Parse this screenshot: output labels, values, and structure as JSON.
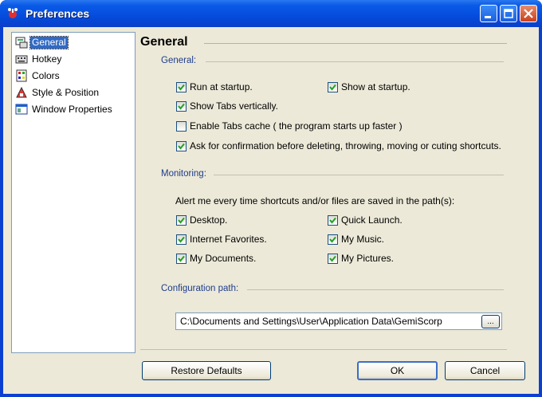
{
  "window": {
    "title": "Preferences",
    "accent": "#0a3fd0"
  },
  "sidebar": {
    "items": [
      {
        "label": "General",
        "icon": "general-settings-icon",
        "selected": true
      },
      {
        "label": "Hotkey",
        "icon": "keyboard-icon",
        "selected": false
      },
      {
        "label": "Colors",
        "icon": "palette-icon",
        "selected": false
      },
      {
        "label": "Style & Position",
        "icon": "style-icon",
        "selected": false
      },
      {
        "label": "Window Properties",
        "icon": "window-icon",
        "selected": false
      }
    ]
  },
  "page": {
    "heading": "General"
  },
  "general": {
    "label": "General:",
    "run_at_startup": {
      "label": "Run at startup.",
      "checked": true
    },
    "show_at_startup": {
      "label": "Show at startup.",
      "checked": true
    },
    "show_tabs_vertically": {
      "label": "Show Tabs vertically.",
      "checked": true
    },
    "enable_tabs_cache": {
      "label": "Enable Tabs cache  ( the program starts up faster )",
      "checked": false
    },
    "ask_confirmation": {
      "label": "Ask for confirmation before deleting, throwing, moving or cuting shortcuts.",
      "checked": true
    }
  },
  "monitoring": {
    "label": "Monitoring:",
    "alert_text": "Alert me every time shortcuts and/or files are saved in the path(s):",
    "desktop": {
      "label": "Desktop.",
      "checked": true
    },
    "quick_launch": {
      "label": "Quick Launch.",
      "checked": true
    },
    "internet_favorites": {
      "label": "Internet Favorites.",
      "checked": true
    },
    "my_music": {
      "label": "My Music.",
      "checked": true
    },
    "my_documents": {
      "label": "My Documents.",
      "checked": true
    },
    "my_pictures": {
      "label": "My Pictures.",
      "checked": true
    }
  },
  "config": {
    "label": "Configuration path:",
    "path": "C:\\Documents and Settings\\User\\Application Data\\GemiScorp",
    "browse_label": "..."
  },
  "buttons": {
    "restore_defaults": "Restore Defaults",
    "ok": "OK",
    "cancel": "Cancel"
  }
}
